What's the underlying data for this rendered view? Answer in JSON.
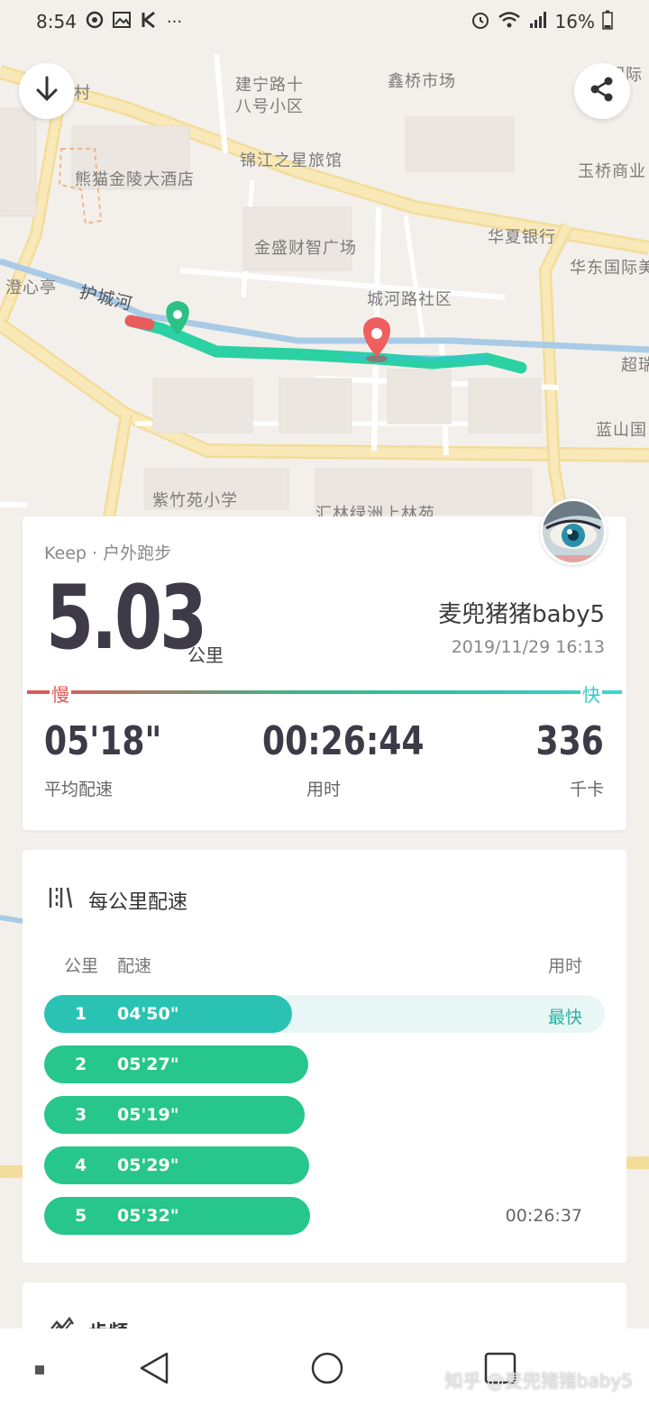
{
  "status_bar": {
    "time": "8:54",
    "battery": "16%",
    "more": "···"
  },
  "map": {
    "labels": {
      "jianning": "建宁路十",
      "jianning2": "八号小区",
      "xinqiao": "鑫桥市场",
      "guoji": "国际",
      "cun": "村",
      "jinjiang": "锦江之星旅馆",
      "xiongmao": "熊猫金陵大酒店",
      "yuqiao": "玉桥商业",
      "jinsheng": "金盛财智广场",
      "huaxia": "华夏银行",
      "huadong": "华东国际美",
      "chengxin": "澄心亭",
      "huchenghe": "护城河",
      "chenghelu": "城河路社区",
      "chao": "超瑞",
      "lanshan": "蓝山国",
      "zizhuyuan": "紫竹苑小学",
      "huilin": "汇林绿洲上林苑"
    }
  },
  "summary": {
    "app": "Keep · 户外跑步",
    "distance": "5.03",
    "unit": "公里",
    "user": "麦兜猪猪baby5",
    "datetime": "2019/11/29 16:13",
    "slow": "慢",
    "fast": "快",
    "stats": {
      "pace_value": "05'18\"",
      "pace_label": "平均配速",
      "time_value": "00:26:44",
      "time_label": "用时",
      "cal_value": "336",
      "cal_label": "千卡"
    }
  },
  "pace_card": {
    "title": "每公里配速",
    "col_km": "公里",
    "col_pace": "配速",
    "col_time": "用时",
    "rows": [
      {
        "km": "1",
        "pace": "04'50\"",
        "fraction": 0.442,
        "right": "最快"
      },
      {
        "km": "2",
        "pace": "05'27\"",
        "fraction": 0.471,
        "right": ""
      },
      {
        "km": "3",
        "pace": "05'19\"",
        "fraction": 0.465,
        "right": ""
      },
      {
        "km": "4",
        "pace": "05'29\"",
        "fraction": 0.472,
        "right": ""
      },
      {
        "km": "5",
        "pace": "05'32\"",
        "fraction": 0.474,
        "right": "00:26:37"
      }
    ]
  },
  "cadence_card": {
    "title": "步频"
  },
  "watermark": "知乎 @麦兜猪猪baby5",
  "colors": {
    "accent_green": "#26c68c",
    "accent_teal": "#2ac3b3",
    "slow_red": "#e25555",
    "fast_cyan": "#34c8c8"
  }
}
